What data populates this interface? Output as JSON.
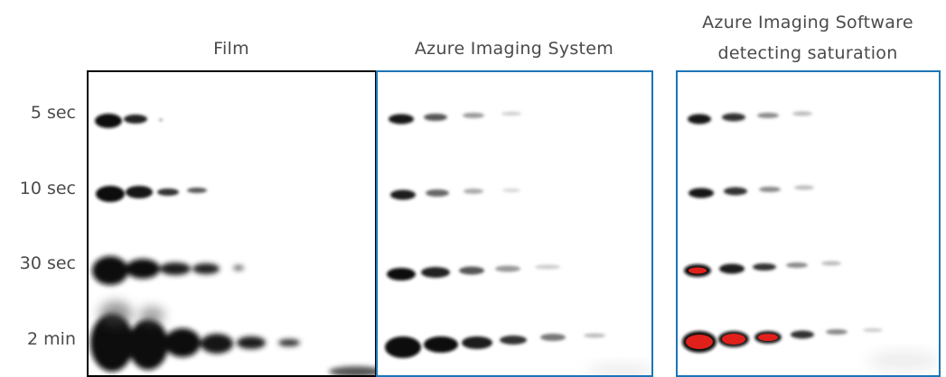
{
  "panels": [
    {
      "id": "film",
      "title_lines": [
        "Film"
      ],
      "border_color": "#000000"
    },
    {
      "id": "system",
      "title_lines": [
        "Azure Imaging System"
      ],
      "border_color": "#1b75b8"
    },
    {
      "id": "software",
      "title_lines": [
        "Azure Imaging Software",
        "detecting saturation"
      ],
      "border_color": "#1b75b8"
    }
  ],
  "rows": [
    {
      "label": "5 sec"
    },
    {
      "label": "10 sec"
    },
    {
      "label": "30 sec"
    },
    {
      "label": "2 min"
    }
  ],
  "colors": {
    "band": "#111111",
    "saturation": "#e0201b",
    "border_film": "#000000",
    "border_azure": "#1b75b8",
    "text": "#4a4a4a"
  }
}
